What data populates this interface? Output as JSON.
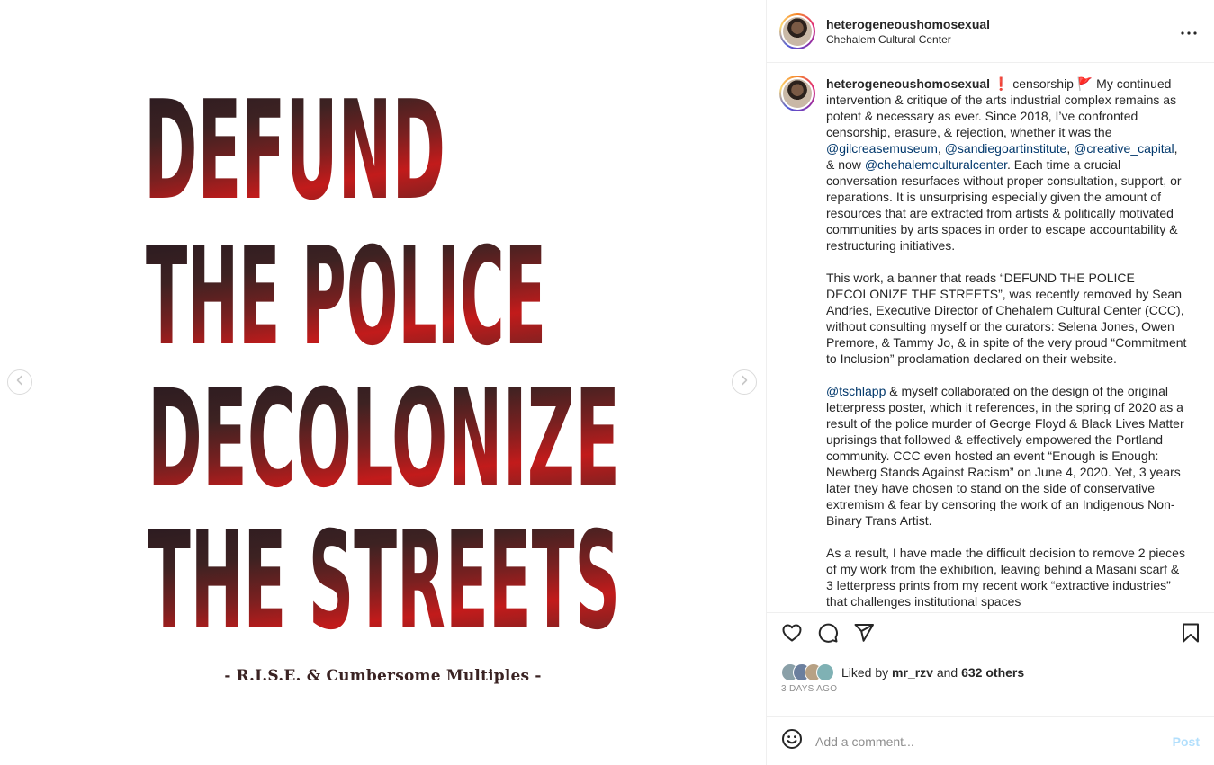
{
  "poster": {
    "lines": [
      "DEFUND",
      "THE POLICE",
      "DECOLONIZE",
      "THE STREETS"
    ],
    "credit": "- R.I.S.E. & Cumbersome Multiples -"
  },
  "header": {
    "username": "heterogeneoushomosexual",
    "location": "Chehalem Cultural Center"
  },
  "caption": {
    "username": "heterogeneoushomosexual",
    "p1_a": " ❗ censorship ",
    "flag": "🚩",
    "p1_b": " My continued intervention & critique of the arts industrial complex remains as potent & necessary as ever. Since 2018, I’ve confronted censorship, erasure, & rejection, whether it was the ",
    "m1": "@gilcreasemuseum",
    "c1": ", ",
    "m2": "@sandiegoartinstitute",
    "c2": ", ",
    "m3": "@creative_capital",
    "c3": ", & now ",
    "m4": "@chehalemculturalcenter",
    "p1_c": ". Each time a crucial conversation resurfaces without proper consultation, support, or reparations. It is unsurprising especially given the amount of resources that are extracted from artists & politically motivated communities by arts spaces in order to escape accountability & restructuring initiatives.",
    "p2": "This work, a banner that reads “DEFUND THE POLICE DECOLONIZE THE STREETS”, was recently removed by Sean Andries, Executive Director of Chehalem Cultural Center (CCC), without consulting myself or the curators: Selena Jones, Owen Premore, & Tammy Jo, & in spite of the very proud “Commitment to Inclusion” proclamation declared on their website.",
    "m5": "@tschlapp",
    "p3": " & myself collaborated on the design of the original letterpress poster, which it references, in the spring of 2020 as a result of the police murder of George Floyd & Black Lives Matter uprisings that followed & effectively empowered the Portland community. CCC even hosted an event “Enough is Enough: Newberg Stands Against Racism” on June 4, 2020. Yet, 3 years later they have chosen to stand on the side of conservative extremism & fear by censoring the work of an Indigenous Non-Binary Trans Artist.",
    "p4": "As a result, I have made the difficult decision to remove 2 pieces of my work from the exhibition, leaving behind a Masani scarf & 3 letterpress prints from my recent work “extractive industries” that challenges institutional spaces"
  },
  "likes": {
    "prefix": "Liked by ",
    "user": "mr_rzv",
    "mid": " and ",
    "others": "632 others"
  },
  "time_ago": "3 DAYS AGO",
  "comment": {
    "placeholder": "Add a comment...",
    "post_label": "Post"
  },
  "icons": {
    "prev": "chevron-left-icon",
    "next": "chevron-right-icon",
    "more": "more-horizontal-icon",
    "like": "heart-icon",
    "comment": "comment-bubble-icon",
    "share": "paper-plane-icon",
    "save": "bookmark-icon",
    "emoji": "smiley-icon"
  },
  "colors": {
    "link": "#00376b",
    "post_disabled": "#b2dffc",
    "poster_dark": "#2a1a22",
    "poster_red": "#c41c1c"
  }
}
